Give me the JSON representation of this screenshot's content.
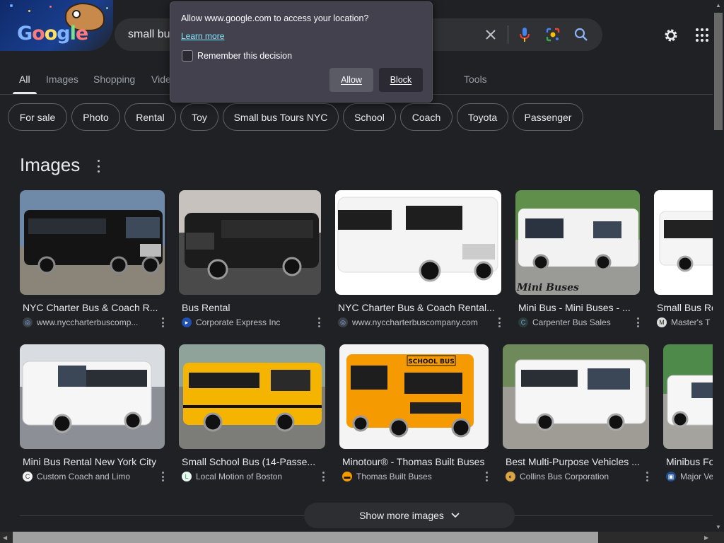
{
  "header": {
    "search_query": "small bus",
    "logo_letters": [
      "G",
      "o",
      "o",
      "g",
      "l",
      "e"
    ]
  },
  "tabs": [
    {
      "label": "All",
      "active": true
    },
    {
      "label": "Images"
    },
    {
      "label": "Shopping"
    },
    {
      "label": "Vide"
    },
    {
      "label": "Tools"
    }
  ],
  "chips": [
    "For sale",
    "Photo",
    "Rental",
    "Toy",
    "Small bus Tours NYC",
    "School",
    "Coach",
    "Toyota",
    "Passenger"
  ],
  "images_section": {
    "title": "Images",
    "show_more": "Show more images"
  },
  "image_results": [
    {
      "title": "NYC Charter Bus & Coach R...",
      "source": "www.nyccharterbuscomp...",
      "bus_color": "#141414"
    },
    {
      "title": "Bus Rental",
      "source": "Corporate Express Inc",
      "bus_color": "#1c1c1c"
    },
    {
      "title": "NYC Charter Bus & Coach Rental...",
      "source": "www.nyccharterbuscompany.com",
      "bus_color": "#f4f4f4"
    },
    {
      "title": "Mini Bus - Mini Buses - ...",
      "source": "Carpenter Bus Sales",
      "bus_color": "#f2f2f2",
      "watermark": "Mini Buses"
    },
    {
      "title": "Small Bus Re",
      "source": "Master's T",
      "bus_color": "#f5f5f5"
    },
    {
      "title": "Mini Bus Rental New York City",
      "source": "Custom Coach and Limo",
      "bus_color": "#f6f6f6"
    },
    {
      "title": "Small School Bus (14-Passe...",
      "source": "Local Motion of Boston",
      "bus_color": "#f5b400"
    },
    {
      "title": "Minotour® - Thomas Built Buses",
      "source": "Thomas Built Buses",
      "bus_color": "#f59a00",
      "sign": "SCHOOL BUS"
    },
    {
      "title": "Best Multi-Purpose Vehicles ...",
      "source": "Collins Bus Corporation",
      "bus_color": "#f6f6f6"
    },
    {
      "title": "Minibus Fo",
      "source": "Major Ve",
      "bus_color": "#f6f6f6"
    }
  ],
  "location_prompt": {
    "message": "Allow www.google.com to access your location?",
    "learn_more": "Learn more",
    "remember_label": "Remember this decision",
    "remember_checked": false,
    "allow_label": "Allow",
    "block_label": "Block"
  },
  "colors": {
    "background": "#202124",
    "search_box": "#303134",
    "popup": "#42414d",
    "link": "#80ebff"
  }
}
